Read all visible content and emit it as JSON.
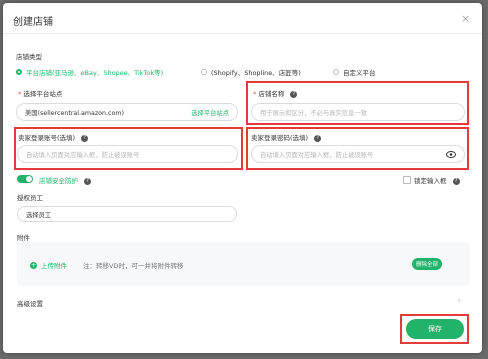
{
  "dialog": {
    "title": "创建店铺",
    "close_glyph": "×"
  },
  "store_type": {
    "label": "店铺类型",
    "options": [
      {
        "label": "平台店铺(亚马逊、eBay、Shopee、TikTok等)",
        "selected": true
      },
      {
        "label": "(Shopify、Shopline、店匠等)",
        "selected": false
      },
      {
        "label": "自定义平台",
        "selected": false
      }
    ]
  },
  "platform_site": {
    "required_mark": "*",
    "label": "选择平台站点",
    "value": "美国(sellercentral.amazon.com)",
    "action": "选择平台站点"
  },
  "store_name": {
    "required_mark": "*",
    "label": "店铺名称",
    "placeholder": "用于展示和区分，不必与真实信息一致"
  },
  "seller_account": {
    "label": "卖家登录账号(选填)",
    "placeholder": "自动填入页面对应输入框，防止被误账号"
  },
  "seller_password": {
    "label": "卖家登录密码(选填)",
    "placeholder": "自动填入页面对应输入框，防止被误账号"
  },
  "security": {
    "label": "店铺安全防护",
    "enabled": true,
    "lock_label": "锁定输入框",
    "lock_checked": false
  },
  "employee": {
    "label": "授权员工",
    "placeholder": "选择员工"
  },
  "attachment": {
    "label": "附件",
    "upload_label": "上传附件",
    "note": "注：转移VD时，可一并将附件转移",
    "delete_all": "删除全部"
  },
  "advanced": {
    "label": "高级设置",
    "chevron": "›"
  },
  "footer": {
    "save_label": "保存"
  },
  "colors": {
    "accent": "#22b36a",
    "highlight": "#e53a3a"
  }
}
